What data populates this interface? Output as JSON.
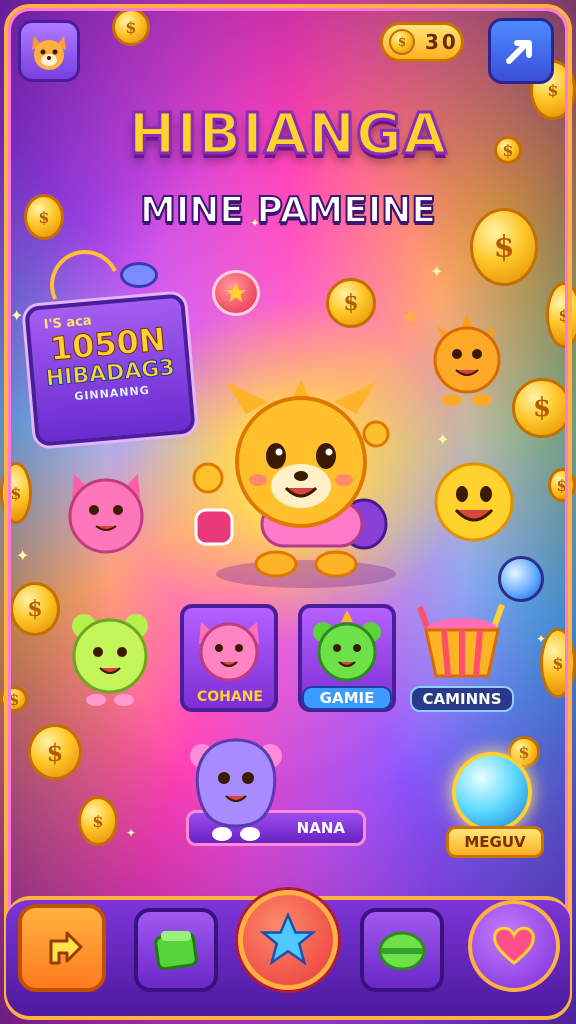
{
  "header": {
    "coins_value": "30",
    "profile_icon": "fox-face-icon",
    "share_icon": "arrow-out-icon"
  },
  "title": {
    "main": "HIBIANGA",
    "subtitle": "MINE PAMEINE"
  },
  "promo_panel": {
    "line1": "I'S aca",
    "line2": "1050N",
    "line3": "HIBADAG3",
    "line4": "GINNANNG"
  },
  "game_cards": [
    {
      "label": "COHANE",
      "icon": "pink-cat-icon"
    },
    {
      "label": "GAMIE",
      "icon": "green-bear-icon"
    },
    {
      "label": "CAMINNS",
      "icon": "candy-bucket-icon"
    }
  ],
  "purple_monster_label": "NANA",
  "gem_label": "MEGUV",
  "bottom_nav": [
    {
      "icon": "arrow-icon"
    },
    {
      "icon": "green-block-icon"
    },
    {
      "icon": "star-icon"
    },
    {
      "icon": "green-orb-icon"
    },
    {
      "icon": "heart-icon"
    }
  ],
  "colors": {
    "accent_gold": "#ffd22e",
    "frame_orange": "#ffb23f",
    "panel_purple": "#7d35d8"
  }
}
